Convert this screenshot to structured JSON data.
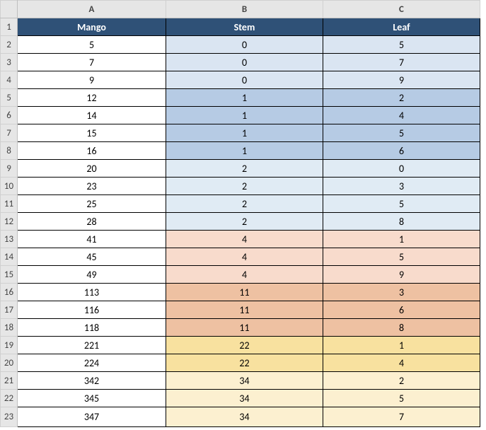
{
  "columns": [
    "A",
    "B",
    "C"
  ],
  "headers": {
    "A": "Mango",
    "B": "Stem",
    "C": "Leaf"
  },
  "rows": [
    {
      "num": 2,
      "mango": "5",
      "stem": "0",
      "leaf": "5",
      "color_b": "#dae5f2",
      "color_c": "#dae5f2"
    },
    {
      "num": 3,
      "mango": "7",
      "stem": "0",
      "leaf": "7",
      "color_b": "#dae5f2",
      "color_c": "#dae5f2"
    },
    {
      "num": 4,
      "mango": "9",
      "stem": "0",
      "leaf": "9",
      "color_b": "#dae5f2",
      "color_c": "#dae5f2"
    },
    {
      "num": 5,
      "mango": "12",
      "stem": "1",
      "leaf": "2",
      "color_b": "#b6cbe4",
      "color_c": "#b6cbe4"
    },
    {
      "num": 6,
      "mango": "14",
      "stem": "1",
      "leaf": "4",
      "color_b": "#b6cbe4",
      "color_c": "#b6cbe4"
    },
    {
      "num": 7,
      "mango": "15",
      "stem": "1",
      "leaf": "5",
      "color_b": "#b6cbe4",
      "color_c": "#b6cbe4"
    },
    {
      "num": 8,
      "mango": "16",
      "stem": "1",
      "leaf": "6",
      "color_b": "#b6cbe4",
      "color_c": "#b6cbe4"
    },
    {
      "num": 9,
      "mango": "20",
      "stem": "2",
      "leaf": "0",
      "color_b": "#e0ebf4",
      "color_c": "#e0ebf4"
    },
    {
      "num": 10,
      "mango": "23",
      "stem": "2",
      "leaf": "3",
      "color_b": "#e0ebf4",
      "color_c": "#e0ebf4"
    },
    {
      "num": 11,
      "mango": "25",
      "stem": "2",
      "leaf": "5",
      "color_b": "#e0ebf4",
      "color_c": "#e0ebf4"
    },
    {
      "num": 12,
      "mango": "28",
      "stem": "2",
      "leaf": "8",
      "color_b": "#e0ebf4",
      "color_c": "#e0ebf4"
    },
    {
      "num": 13,
      "mango": "41",
      "stem": "4",
      "leaf": "1",
      "color_b": "#f8dbcc",
      "color_c": "#f8dbcc"
    },
    {
      "num": 14,
      "mango": "45",
      "stem": "4",
      "leaf": "5",
      "color_b": "#f8dbcc",
      "color_c": "#f8dbcc"
    },
    {
      "num": 15,
      "mango": "49",
      "stem": "4",
      "leaf": "9",
      "color_b": "#f8dbcc",
      "color_c": "#f8dbcc"
    },
    {
      "num": 16,
      "mango": "113",
      "stem": "11",
      "leaf": "3",
      "color_b": "#eec1a2",
      "color_c": "#eec1a2"
    },
    {
      "num": 17,
      "mango": "116",
      "stem": "11",
      "leaf": "6",
      "color_b": "#eec1a2",
      "color_c": "#eec1a2"
    },
    {
      "num": 18,
      "mango": "118",
      "stem": "11",
      "leaf": "8",
      "color_b": "#eec1a2",
      "color_c": "#eec1a2"
    },
    {
      "num": 19,
      "mango": "221",
      "stem": "22",
      "leaf": "1",
      "color_b": "#f8e19f",
      "color_c": "#f8e19f"
    },
    {
      "num": 20,
      "mango": "224",
      "stem": "22",
      "leaf": "4",
      "color_b": "#f8e19f",
      "color_c": "#f8e19f"
    },
    {
      "num": 21,
      "mango": "342",
      "stem": "34",
      "leaf": "2",
      "color_b": "#fcf0d0",
      "color_c": "#fcf0d0"
    },
    {
      "num": 22,
      "mango": "345",
      "stem": "34",
      "leaf": "5",
      "color_b": "#fcf0d0",
      "color_c": "#fcf0d0"
    },
    {
      "num": 23,
      "mango": "347",
      "stem": "34",
      "leaf": "7",
      "color_b": "#fcf0d0",
      "color_c": "#fcf0d0"
    }
  ]
}
